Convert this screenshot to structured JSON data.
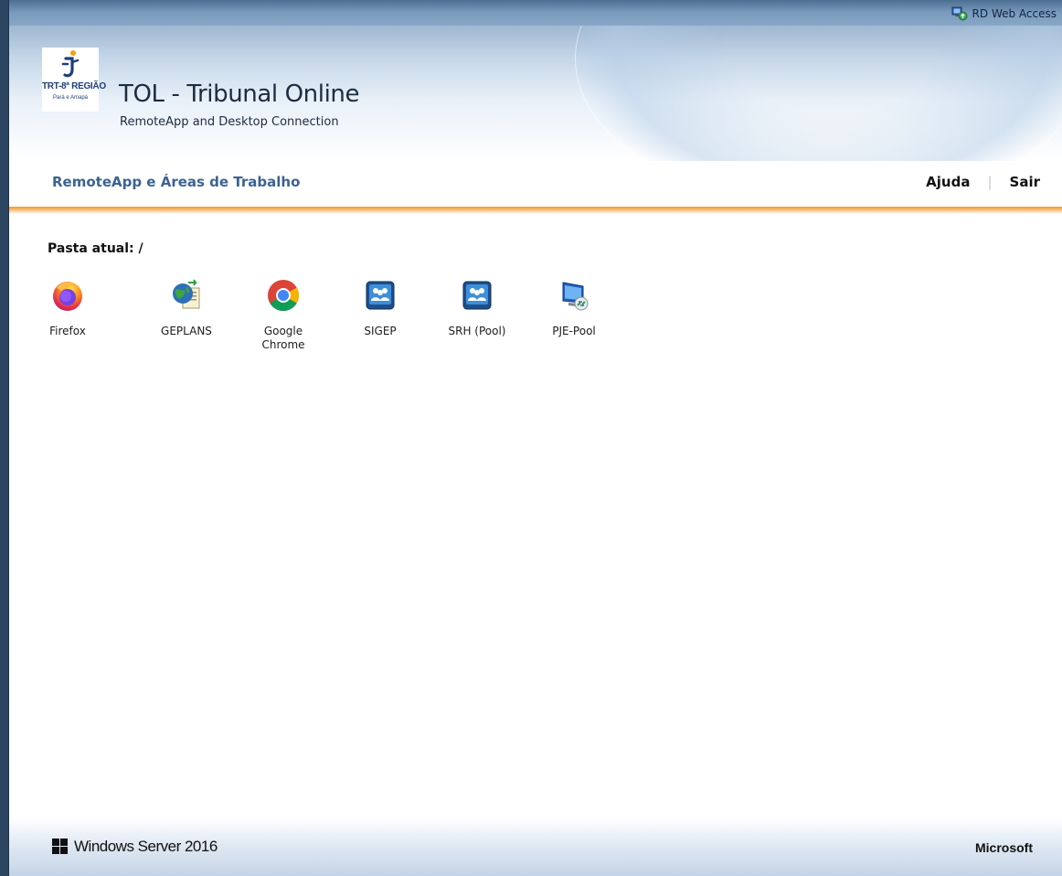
{
  "top_bar": {
    "rd_web_access_label": "RD Web Access",
    "rd_icon": "rd-web-access-icon"
  },
  "header": {
    "logo": {
      "line1": "TRT-8ª REGIÃO",
      "line2": "Pará e Amapá"
    },
    "title": "TOL - Tribunal Online",
    "subtitle": "RemoteApp and Desktop Connection"
  },
  "nav": {
    "title": "RemoteApp e Áreas de Trabalho",
    "help_label": "Ajuda",
    "logout_label": "Sair",
    "separator": "|"
  },
  "content": {
    "folder_label": "Pasta atual: /",
    "apps": [
      {
        "label": "Firefox",
        "icon": "firefox-icon"
      },
      {
        "label": "GEPLANS",
        "icon": "geplans-icon"
      },
      {
        "label": "Google Chrome",
        "icon": "chrome-icon"
      },
      {
        "label": "SIGEP",
        "icon": "sigep-icon"
      },
      {
        "label": "SRH (Pool)",
        "icon": "srh-pool-icon"
      },
      {
        "label": "PJE-Pool",
        "icon": "remote-desktop-icon"
      }
    ]
  },
  "footer": {
    "windows_brand": "Windows Server 2016",
    "microsoft_brand": "Microsoft"
  },
  "colors": {
    "accent_blue": "#3c6392",
    "orange_line": "#f29a33",
    "top_strip": "#7a9bbd"
  }
}
